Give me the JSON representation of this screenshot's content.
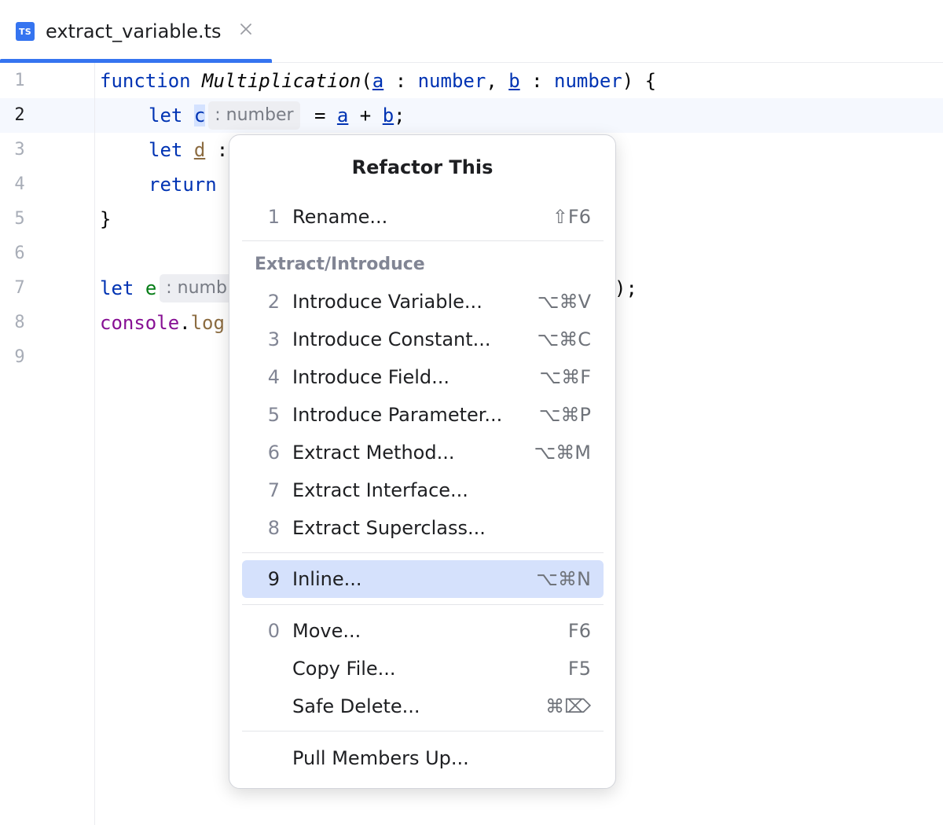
{
  "tab": {
    "icon_text": "TS",
    "title": "extract_variable.ts"
  },
  "editor": {
    "line_numbers": [
      "1",
      "2",
      "3",
      "4",
      "5",
      "6",
      "7",
      "8",
      "9"
    ],
    "l1": {
      "kw": "function",
      "fn": "Multiplication",
      "open": "(",
      "a": "a",
      "colon1": " : ",
      "t1": "number",
      "comma": ", ",
      "b": "b",
      "colon2": " : ",
      "t2": "number",
      "close": ") {"
    },
    "l2": {
      "kw": "let",
      "var": "c",
      "hint": ": number",
      "eq": " = ",
      "a": "a",
      "plus": " + ",
      "b": "b",
      "semi": ";"
    },
    "l3": {
      "kw": "let",
      "var": "d",
      "rest": " :"
    },
    "l4": {
      "kw": "return"
    },
    "l5": {
      "brace": "}"
    },
    "l7": {
      "kw": "let",
      "var": "e",
      "hint": ": numb",
      "tail": ");"
    },
    "l8": {
      "obj": "console",
      "dot": ".",
      "meth": "log"
    }
  },
  "popup": {
    "title": "Refactor This",
    "group_label": "Extract/Introduce",
    "items": [
      {
        "num": "1",
        "label": "Rename...",
        "shortcut": "⇧F6"
      },
      {
        "num": "2",
        "label": "Introduce Variable...",
        "shortcut": "⌥⌘V"
      },
      {
        "num": "3",
        "label": "Introduce Constant...",
        "shortcut": "⌥⌘C"
      },
      {
        "num": "4",
        "label": "Introduce Field...",
        "shortcut": "⌥⌘F"
      },
      {
        "num": "5",
        "label": "Introduce Parameter...",
        "shortcut": "⌥⌘P"
      },
      {
        "num": "6",
        "label": "Extract Method...",
        "shortcut": "⌥⌘M"
      },
      {
        "num": "7",
        "label": "Extract Interface...",
        "shortcut": ""
      },
      {
        "num": "8",
        "label": "Extract Superclass...",
        "shortcut": ""
      },
      {
        "num": "9",
        "label": "Inline...",
        "shortcut": "⌥⌘N"
      },
      {
        "num": "0",
        "label": "Move...",
        "shortcut": "F6"
      },
      {
        "num": "",
        "label": "Copy File...",
        "shortcut": "F5"
      },
      {
        "num": "",
        "label": "Safe Delete...",
        "shortcut": "⌘⌦"
      },
      {
        "num": "",
        "label": "Pull Members Up...",
        "shortcut": ""
      }
    ]
  },
  "colors": {
    "accent": "#3574f0",
    "selection": "#d5e1fc",
    "keyword": "#0033b3"
  }
}
